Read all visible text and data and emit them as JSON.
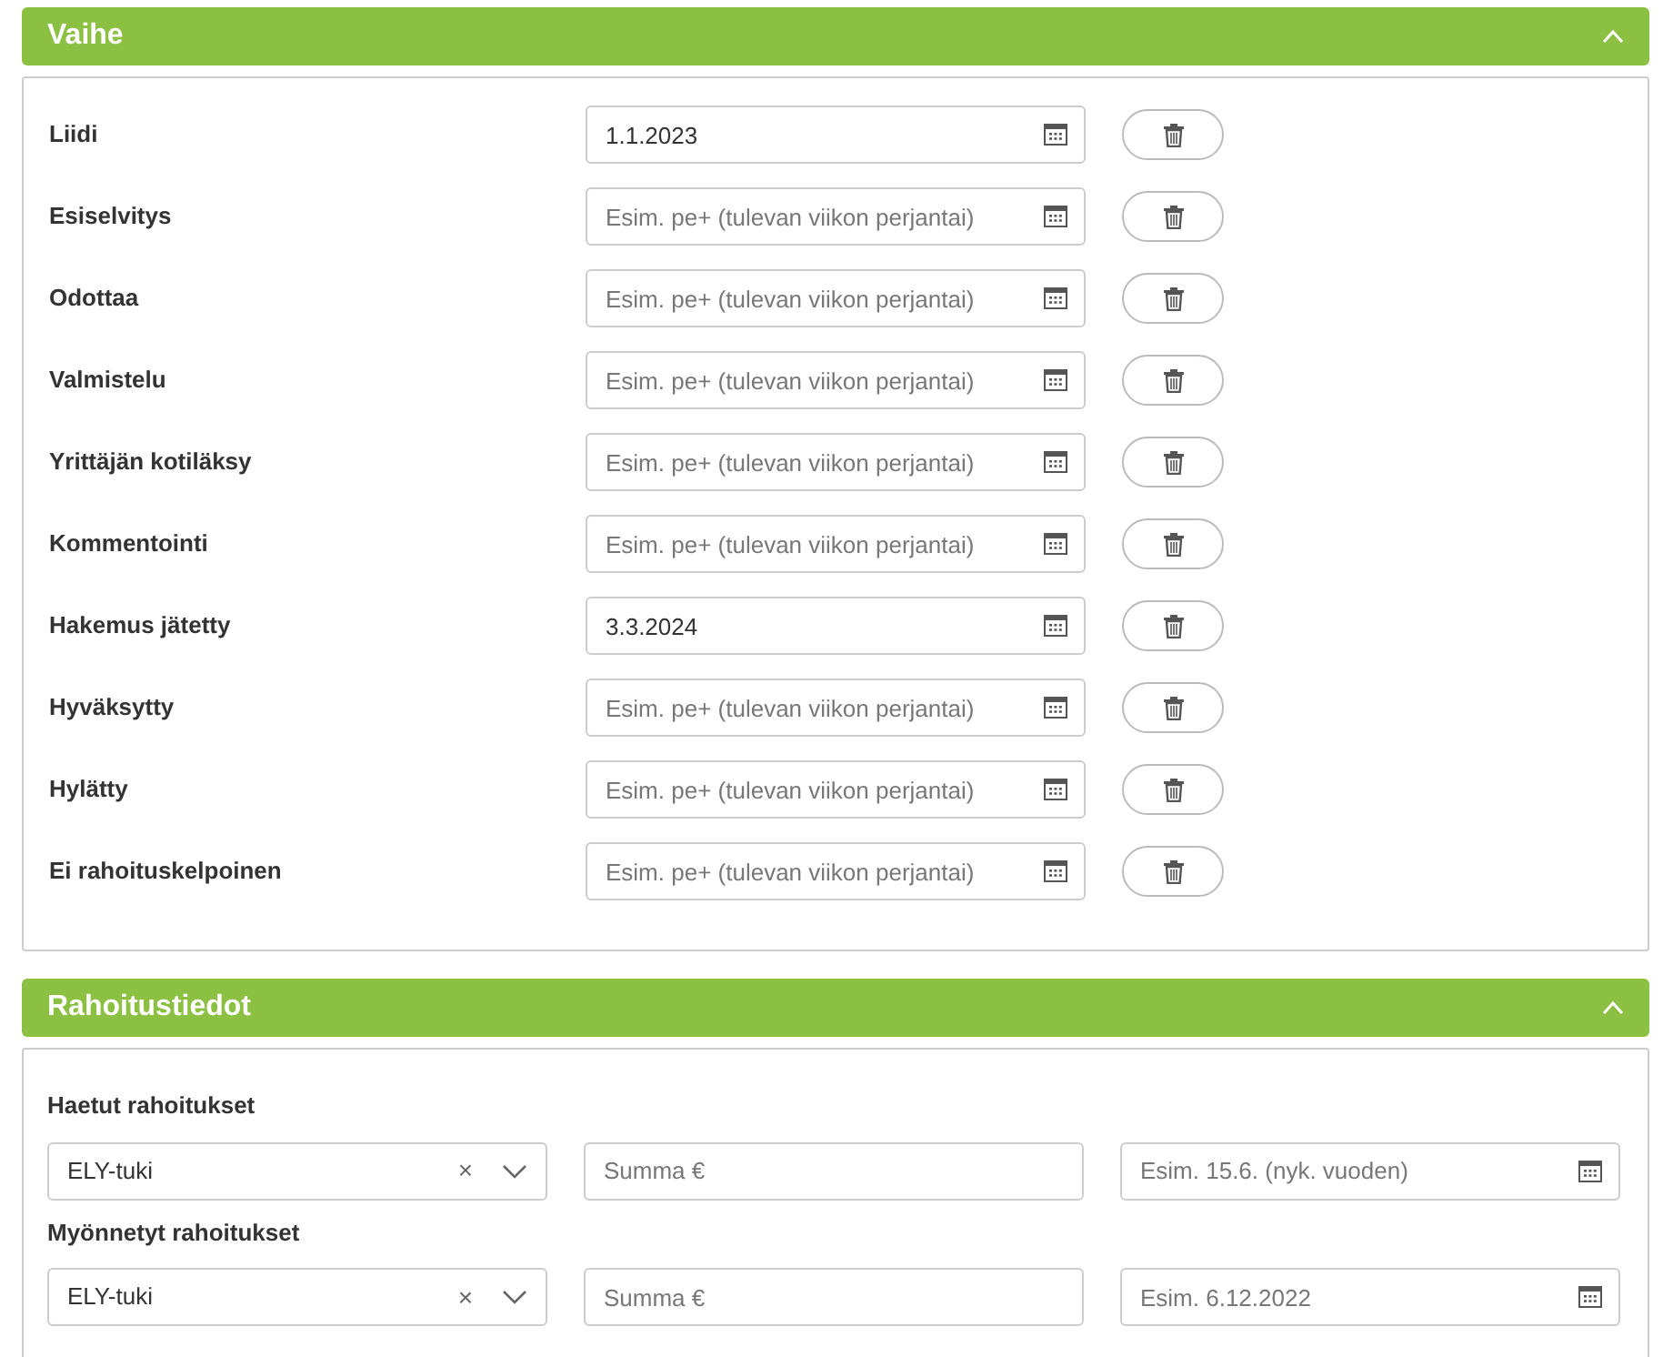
{
  "sections": [
    {
      "title": "Vaihe",
      "expanded": true,
      "kind": "stages",
      "rows": [
        {
          "label": "Liidi",
          "value": "1.1.2023"
        },
        {
          "label": "Esiselvitys",
          "placeholder": "Esim. pe+ (tulevan viikon perjantai)"
        },
        {
          "label": "Odottaa",
          "placeholder": "Esim. pe+ (tulevan viikon perjantai)"
        },
        {
          "label": "Valmistelu",
          "placeholder": "Esim. pe+ (tulevan viikon perjantai)"
        },
        {
          "label": "Yrittäjän kotiläksy",
          "placeholder": "Esim. pe+ (tulevan viikon perjantai)"
        },
        {
          "label": "Kommentointi",
          "placeholder": "Esim. pe+ (tulevan viikon perjantai)"
        },
        {
          "label": "Hakemus jätetty",
          "value": "3.3.2024"
        },
        {
          "label": "Hyväksytty",
          "placeholder": "Esim. pe+ (tulevan viikon perjantai)"
        },
        {
          "label": "Hylätty",
          "placeholder": "Esim. pe+ (tulevan viikon perjantai)"
        },
        {
          "label": "Ei rahoituskelpoinen",
          "placeholder": "Esim. pe+ (tulevan viikon perjantai)"
        }
      ]
    },
    {
      "title": "Rahoitustiedot",
      "expanded": true,
      "kind": "funding",
      "groups": [
        {
          "label": "Haetut rahoitukset",
          "select": {
            "value": "ELY-tuki",
            "clear": "×"
          },
          "amount": {
            "placeholder": "Summa €"
          },
          "date": {
            "placeholder": "Esim. 15.6. (nyk. vuoden)"
          }
        },
        {
          "label": "Myönnetyt rahoitukset",
          "select": {
            "value": "ELY-tuki",
            "clear": "×"
          },
          "amount": {
            "placeholder": "Summa €"
          },
          "date": {
            "placeholder": "Esim. 6.12.2022"
          }
        }
      ]
    }
  ]
}
